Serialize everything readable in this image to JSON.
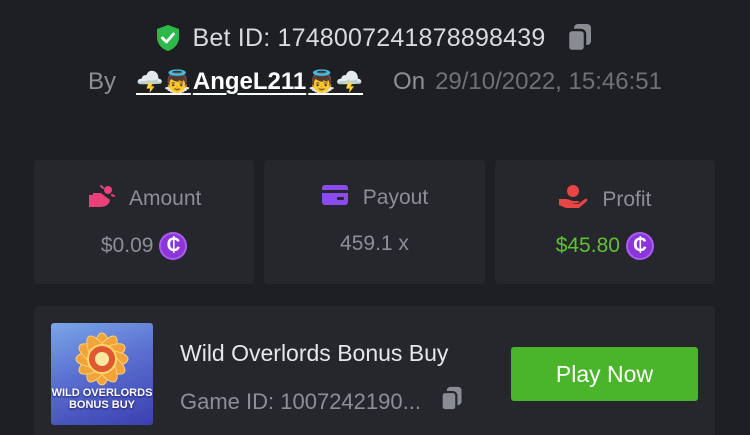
{
  "header": {
    "bet_id_text": "Bet ID: 1748007241878898439",
    "by_label": "By",
    "user_name": "AngeL211",
    "user_emoji_left": "🌩️👼",
    "user_emoji_right": "👼🌩️",
    "on_label": "On",
    "timestamp": "29/10/2022, 15:46:51"
  },
  "stats": {
    "amount": {
      "label": "Amount",
      "value": "$0.09",
      "currency_symbol": "₵"
    },
    "payout": {
      "label": "Payout",
      "value": "459.1 x"
    },
    "profit": {
      "label": "Profit",
      "value": "$45.80",
      "currency_symbol": "₵"
    }
  },
  "game": {
    "name": "Wild Overlords Bonus Buy",
    "id_text": "Game ID: 1007242190...",
    "thumb_line1": "WILD OVERLORDS",
    "thumb_line2": "BONUS BUY",
    "play_label": "Play Now"
  },
  "colors": {
    "background": "#1e1f23",
    "card": "#26272c",
    "accent_green": "#4ab52a",
    "profit_green": "#5ec232",
    "coin_purple": "#8c35d9",
    "amount_icon": "#e8417a",
    "payout_icon": "#8a4cf0",
    "profit_icon": "#e84545",
    "shield_green": "#2fb84a"
  },
  "icons": {
    "shield": "shield-check-icon",
    "copy": "copy-icon",
    "amount": "money-bag-icon",
    "payout": "card-icon",
    "profit": "hand-coin-icon",
    "coin": "coin-icon"
  }
}
